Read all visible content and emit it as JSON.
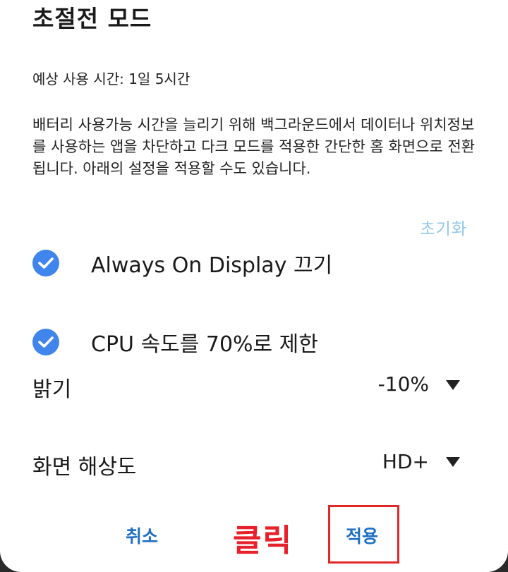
{
  "dialog": {
    "title": "초절전 모드",
    "estimate": "예상 사용 시간: 1일 5시간",
    "description": "배터리 사용가능 시간을 늘리기 위해 백그라운드에서 데이터나 위치정보를 사용하는 앱을 차단하고 다크 모드를 적용한 간단한 홈 화면으로 전환됩니다. 아래의 설정을 적용할 수도 있습니다.",
    "reset_label": "초기화",
    "options": [
      {
        "label": "Always On Display 끄기",
        "checked": true
      },
      {
        "label": "CPU 속도를 70%로 제한",
        "checked": true
      }
    ],
    "brightness": {
      "label": "밝기",
      "value": "-10%"
    },
    "resolution": {
      "label": "화면 해상도",
      "value": "HD+"
    },
    "buttons": {
      "cancel": "취소",
      "apply": "적용"
    }
  },
  "annotation": {
    "click_text": "클릭",
    "color": "#e8202a"
  },
  "colors": {
    "accent": "#3f85eb",
    "button_text": "#1e6fc4",
    "reset": "#8ec6ea"
  }
}
